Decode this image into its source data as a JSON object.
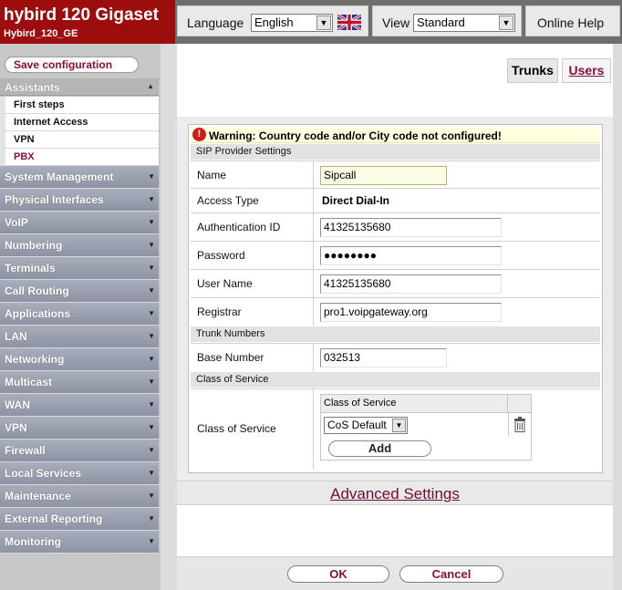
{
  "header": {
    "brand_title": "hybird 120 Gigaset",
    "brand_subtitle": "Hybird_120_GE",
    "language_label": "Language",
    "language_value": "English",
    "view_label": "View",
    "view_value": "Standard",
    "online_help": "Online Help"
  },
  "sidebar": {
    "save_configuration": "Save configuration",
    "assistants": {
      "label": "Assistants",
      "items": [
        "First steps",
        "Internet Access",
        "VPN",
        "PBX"
      ],
      "active": "PBX"
    },
    "menu": [
      "System Management",
      "Physical Interfaces",
      "VoIP",
      "Numbering",
      "Terminals",
      "Call Routing",
      "Applications",
      "LAN",
      "Networking",
      "Multicast",
      "WAN",
      "VPN",
      "Firewall",
      "Local Services",
      "Maintenance",
      "External Reporting",
      "Monitoring"
    ]
  },
  "tabs": {
    "trunks": "Trunks",
    "users": "Users",
    "active": "Trunks"
  },
  "form": {
    "warning": "Warning: Country code and/or City code not configured!",
    "sip_section": "SIP Provider Settings",
    "name_label": "Name",
    "name_value": "Sipcall",
    "access_type_label": "Access Type",
    "access_type_value": "Direct Dial-In",
    "auth_id_label": "Authentication ID",
    "auth_id_value": "41325135680",
    "password_label": "Password",
    "password_value": "●●●●●●●●",
    "user_name_label": "User Name",
    "user_name_value": "41325135680",
    "registrar_label": "Registrar",
    "registrar_value": "pro1.voipgateway.org",
    "trunk_section": "Trunk Numbers",
    "base_number_label": "Base Number",
    "base_number_value": "032513",
    "cos_section": "Class of Service",
    "cos_label": "Class of Service",
    "cos_table_header": "Class of Service",
    "cos_value": "CoS Default",
    "add_button": "Add"
  },
  "advanced_settings": "Advanced Settings",
  "footer": {
    "ok": "OK",
    "cancel": "Cancel"
  },
  "colors": {
    "brand": "#9d0d0d",
    "accent": "#8a0d3b",
    "menu": "#9aa0b0"
  }
}
